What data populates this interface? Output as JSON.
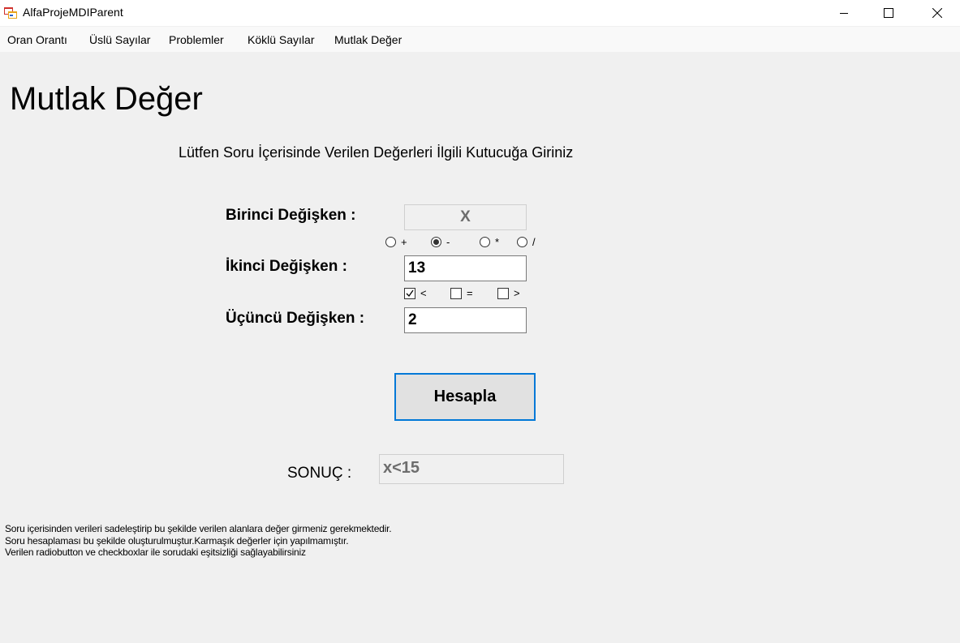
{
  "window": {
    "title": "AlfaProjeMDIParent",
    "minimize_icon": "minimize-icon",
    "maximize_icon": "maximize-icon",
    "close_icon": "close-icon"
  },
  "menu": {
    "items": [
      "Oran Orantı",
      "Üslü Sayılar",
      "Problemler",
      "Köklü Sayılar",
      "Mutlak Değer"
    ]
  },
  "form": {
    "heading": "Mutlak Değer",
    "instruction": "Lütfen Soru İçerisinde Verilen Değerleri İlgili Kutucuğa Giriniz",
    "first_label": "Birinci Değişken  :",
    "first_value": "X",
    "operators": [
      {
        "label": "+",
        "checked": false
      },
      {
        "label": "-",
        "checked": true
      },
      {
        "label": "*",
        "checked": false
      },
      {
        "label": "/",
        "checked": false
      }
    ],
    "second_label": "İkinci Değişken :",
    "second_value": "13",
    "comparisons": [
      {
        "label": "<",
        "checked": true
      },
      {
        "label": "=",
        "checked": false
      },
      {
        "label": ">",
        "checked": false
      }
    ],
    "third_label": "Üçüncü Değişken :",
    "third_value": "2",
    "calculate_label": "Hesapla",
    "result_label": "SONUÇ :",
    "result_value": "x<15"
  },
  "notes": [
    "Soru içerisinden verileri sadeleştirip bu şekilde verilen alanlara değer girmeniz gerekmektedir.",
    "Soru hesaplaması bu şekilde oluşturulmuştur.Karmaşık değerler için yapılmamıştır.",
    "Verilen radiobutton ve checkboxlar ile sorudaki eşitsizliği sağlayabilirsiniz"
  ]
}
